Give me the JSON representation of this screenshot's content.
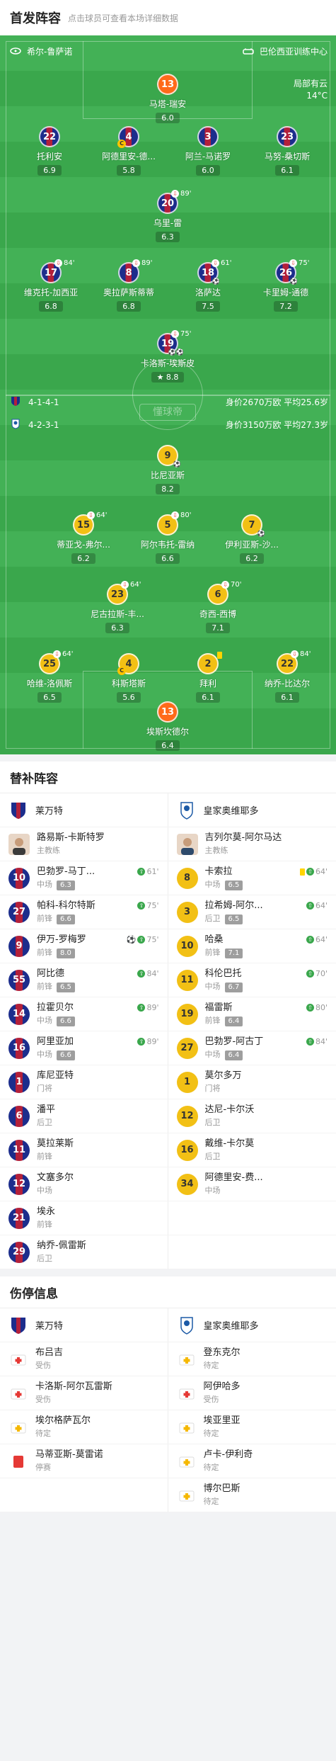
{
  "header": {
    "title": "首发阵容",
    "subtitle": "点击球员可查看本场详细数据"
  },
  "pitch": {
    "home_team": "希尔-鲁萨诺",
    "away_team": "巴伦西亚训练中心",
    "weather": "局部有云",
    "temp": "14°C",
    "watermark": "懂球帝",
    "home_formation": "4-1-4-1",
    "home_value": "身价2670万欧 平均25.6岁",
    "away_formation": "4-2-3-1",
    "away_value": "身价3150万欧 平均27.3岁"
  },
  "home_players": [
    {
      "num": "13",
      "name": "马塔-瑞安",
      "rating": "6.0"
    },
    {
      "num": "22",
      "name": "托利安",
      "rating": "6.9"
    },
    {
      "num": "4",
      "name": "阿德里安-德...",
      "rating": "5.8"
    },
    {
      "num": "3",
      "name": "阿兰-马诺罗",
      "rating": "6.0"
    },
    {
      "num": "23",
      "name": "马努-桑切斯",
      "rating": "6.1"
    },
    {
      "num": "20",
      "name": "乌里-雷",
      "rating": "6.3",
      "sub": "89'"
    },
    {
      "num": "17",
      "name": "维克托-加西亚",
      "rating": "6.8",
      "sub": "84'"
    },
    {
      "num": "8",
      "name": "奥拉萨斯蒂蒂",
      "rating": "6.8",
      "sub": "89'"
    },
    {
      "num": "18",
      "name": "洛萨达",
      "rating": "7.5",
      "sub": "61'"
    },
    {
      "num": "26",
      "name": "卡里姆-通德",
      "rating": "7.2",
      "sub": "75'"
    },
    {
      "num": "19",
      "name": "卡洛斯-埃斯皮",
      "rating": "8.8",
      "sub": "75'"
    }
  ],
  "away_players": [
    {
      "num": "9",
      "name": "比尼亚斯",
      "rating": "8.2"
    },
    {
      "num": "15",
      "name": "蒂亚戈-弗尔...",
      "rating": "6.2",
      "sub": "64'"
    },
    {
      "num": "5",
      "name": "阿尔韦托-雷纳",
      "rating": "6.6",
      "sub": "80'"
    },
    {
      "num": "7",
      "name": "伊利亚斯-沙...",
      "rating": "6.2"
    },
    {
      "num": "23",
      "name": "尼古拉斯-丰...",
      "rating": "6.3",
      "sub": "64'"
    },
    {
      "num": "6",
      "name": "奇西-西博",
      "rating": "7.1",
      "sub": "70'"
    },
    {
      "num": "25",
      "name": "哈维-洛佩斯",
      "rating": "6.5",
      "sub": "64'"
    },
    {
      "num": "4",
      "name": "科斯塔斯",
      "rating": "5.6"
    },
    {
      "num": "2",
      "name": "拜利",
      "rating": "6.1"
    },
    {
      "num": "22",
      "name": "纳乔-比达尔",
      "rating": "6.1",
      "sub": "84'"
    },
    {
      "num": "13",
      "name": "埃斯坎德尔",
      "rating": "6.4"
    }
  ],
  "subs": {
    "title": "替补阵容",
    "home_team": "莱万特",
    "away_team": "皇家奥维耶多",
    "home_coach": "路易斯-卡斯特罗",
    "away_coach": "吉列尔莫-阿尔马达",
    "coach_label": "主教练",
    "home": [
      {
        "num": "10",
        "name": "巴勃罗-马丁...",
        "pos": "中场",
        "rating": "6.3",
        "ev": "61'"
      },
      {
        "num": "27",
        "name": "帕科-科尔特斯",
        "pos": "前锋",
        "rating": "6.6",
        "ev": "75'"
      },
      {
        "num": "9",
        "name": "伊万-罗梅罗",
        "pos": "前锋",
        "rating": "8.0",
        "ev": "75'"
      },
      {
        "num": "55",
        "name": "阿比德",
        "pos": "前锋",
        "rating": "6.5",
        "ev": "84'"
      },
      {
        "num": "14",
        "name": "拉霍贝尔",
        "pos": "中场",
        "rating": "6.6",
        "ev": "89'"
      },
      {
        "num": "16",
        "name": "阿里亚加",
        "pos": "中场",
        "rating": "6.6",
        "ev": "89'"
      },
      {
        "num": "1",
        "name": "库尼亚特",
        "pos": "门将"
      },
      {
        "num": "6",
        "name": "潘平",
        "pos": "后卫"
      },
      {
        "num": "11",
        "name": "莫拉莱斯",
        "pos": "前锋"
      },
      {
        "num": "12",
        "name": "文塞多尔",
        "pos": "中场"
      },
      {
        "num": "21",
        "name": "埃永",
        "pos": "前锋"
      },
      {
        "num": "29",
        "name": "纳乔-佩雷斯",
        "pos": "后卫"
      }
    ],
    "away": [
      {
        "num": "8",
        "name": "卡索拉",
        "pos": "中场",
        "rating": "6.5",
        "ev": "64'"
      },
      {
        "num": "3",
        "name": "拉希姆-阿尔...",
        "pos": "后卫",
        "rating": "6.5",
        "ev": "64'"
      },
      {
        "num": "10",
        "name": "哈桑",
        "pos": "前锋",
        "rating": "7.1",
        "ev": "64'"
      },
      {
        "num": "11",
        "name": "科伦巴托",
        "pos": "中场",
        "rating": "6.7",
        "ev": "70'"
      },
      {
        "num": "19",
        "name": "福雷斯",
        "pos": "前锋",
        "rating": "6.4",
        "ev": "80'"
      },
      {
        "num": "27",
        "name": "巴勃罗-阿古丁",
        "pos": "中场",
        "rating": "6.4",
        "ev": "84'"
      },
      {
        "num": "1",
        "name": "莫尔多万",
        "pos": "门将"
      },
      {
        "num": "12",
        "name": "达尼-卡尔沃",
        "pos": "后卫"
      },
      {
        "num": "16",
        "name": "戴维-卡尔莫",
        "pos": "后卫"
      },
      {
        "num": "34",
        "name": "阿德里安-费...",
        "pos": "中场"
      }
    ]
  },
  "injuries": {
    "title": "伤停信息",
    "home_team": "莱万特",
    "away_team": "皇家奥维耶多",
    "home": [
      {
        "name": "布吕吉",
        "status": "受伤",
        "type": "injury"
      },
      {
        "name": "卡洛斯-阿尔瓦雷斯",
        "status": "受伤",
        "type": "injury"
      },
      {
        "name": "埃尔格萨瓦尔",
        "status": "待定",
        "type": "doubt"
      },
      {
        "name": "马蒂亚斯-莫雷诺",
        "status": "停赛",
        "type": "red"
      }
    ],
    "away": [
      {
        "name": "登东克尔",
        "status": "待定",
        "type": "doubt"
      },
      {
        "name": "阿伊哈多",
        "status": "受伤",
        "type": "injury"
      },
      {
        "name": "埃亚里亚",
        "status": "待定",
        "type": "doubt"
      },
      {
        "name": "卢卡-伊利奇",
        "status": "待定",
        "type": "doubt"
      },
      {
        "name": "博尔巴斯",
        "status": "待定",
        "type": "doubt"
      }
    ]
  }
}
